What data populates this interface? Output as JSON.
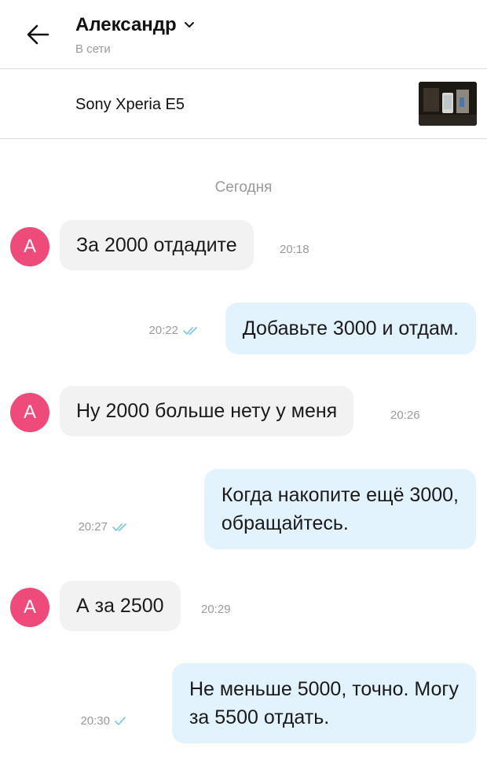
{
  "header": {
    "contact_name": "Александр",
    "status": "В сети"
  },
  "item": {
    "title": "Sony Xperia E5"
  },
  "chat": {
    "date_label": "Сегодня",
    "messages": [
      {
        "direction": "in",
        "avatar": "А",
        "text": "За 2000 отдадите",
        "time": "20:18"
      },
      {
        "direction": "out",
        "text": "Добавьте 3000 и отдам.",
        "time": "20:22",
        "receipt": "double-check-icon"
      },
      {
        "direction": "in",
        "avatar": "А",
        "text": "Ну 2000 больше нету у меня",
        "time": "20:26"
      },
      {
        "direction": "out",
        "lines": [
          "Когда накопите ещё 3000,",
          "обращайтесь."
        ],
        "time": "20:27",
        "receipt": "double-check-icon"
      },
      {
        "direction": "in",
        "avatar": "А",
        "text": "А за 2500",
        "time": "20:29"
      },
      {
        "direction": "out",
        "lines": [
          "Не меньше 5000, точно. Могу",
          "за 5500 отдать."
        ],
        "time": "20:30",
        "receipt": "check-icon"
      }
    ]
  },
  "colors": {
    "avatar": "#ee4a7a",
    "outgoing_bubble": "#e2f3fe",
    "incoming_bubble": "#f2f2f2",
    "receipt": "#79c3ec"
  }
}
